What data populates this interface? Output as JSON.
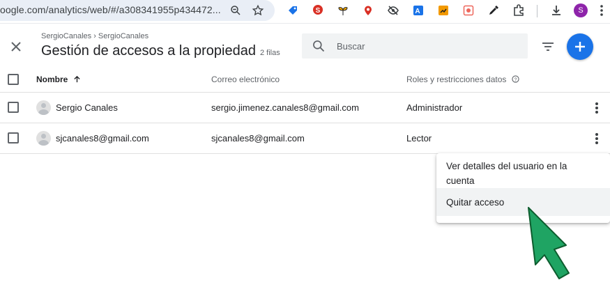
{
  "browser": {
    "url": "oogle.com/analytics/web/#/a308341955p434472...",
    "profile_initial": "S",
    "extensions": [
      "seo-icon",
      "plant-icon",
      "pin-icon",
      "eye-off-icon",
      "translate-icon",
      "chart-icon",
      "capture-icon",
      "eyedropper-icon",
      "puzzle-icon"
    ]
  },
  "header": {
    "breadcrumb": "SergioCanales › SergioCanales",
    "title": "Gestión de accesos a la propiedad",
    "row_count": "2 filas"
  },
  "search": {
    "placeholder": "Buscar"
  },
  "table": {
    "headers": {
      "name": "Nombre",
      "email": "Correo electrónico",
      "roles": "Roles y restricciones datos"
    },
    "rows": [
      {
        "name": "Sergio Canales",
        "email": "sergio.jimenez.canales8@gmail.com",
        "role": "Administrador"
      },
      {
        "name": "sjcanales8@gmail.com",
        "email": "sjcanales8@gmail.com",
        "role": "Lector"
      }
    ]
  },
  "context_menu": {
    "items": [
      {
        "label_line1": "Ver detalles del usuario en la",
        "label_line2": "cuenta"
      },
      {
        "label": "Quitar acceso"
      }
    ]
  },
  "colors": {
    "accent": "#1a73e8",
    "arrow_fill": "#1fa463",
    "arrow_stroke": "#0d5c2e"
  }
}
